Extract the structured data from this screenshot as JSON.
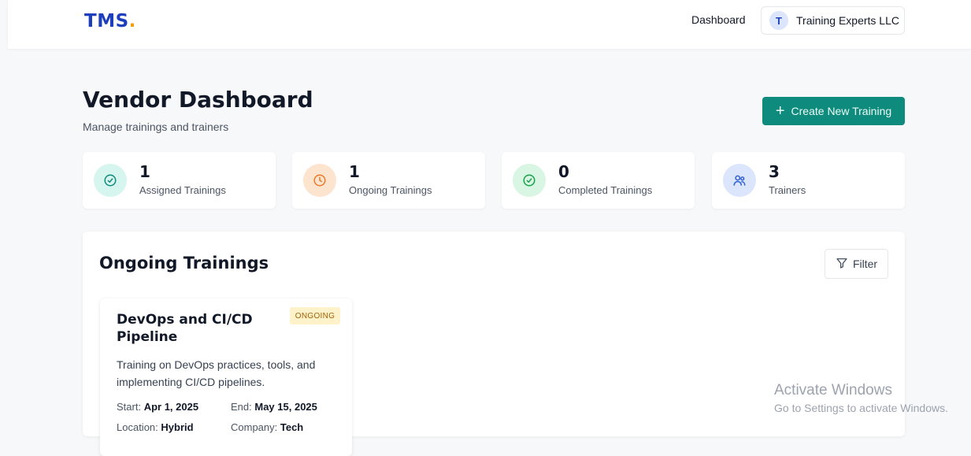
{
  "header": {
    "logo_text": "TMS",
    "logo_dot": ".",
    "nav_dashboard": "Dashboard",
    "user_initial": "T",
    "user_name": "Training Experts LLC"
  },
  "page": {
    "title": "Vendor Dashboard",
    "subtitle": "Manage trainings and trainers",
    "create_button": "Create New Training"
  },
  "stats": [
    {
      "value": "1",
      "label": "Assigned Trainings",
      "icon": "check-circle-icon",
      "color": "#0f8b7d",
      "bg": "#d6f5ee"
    },
    {
      "value": "1",
      "label": "Ongoing Trainings",
      "icon": "clock-icon",
      "color": "#ea7a2b",
      "bg": "#fde4cf"
    },
    {
      "value": "0",
      "label": "Completed Trainings",
      "icon": "check-circle-icon",
      "color": "#16a34a",
      "bg": "#d9f5e3"
    },
    {
      "value": "3",
      "label": "Trainers",
      "icon": "users-icon",
      "color": "#2f5fd0",
      "bg": "#dbe5fb"
    }
  ],
  "ongoing": {
    "title": "Ongoing Trainings",
    "filter_label": "Filter",
    "trainings": [
      {
        "title": "DevOps and CI/CD Pipeline",
        "status": "ONGOING",
        "description": "Training on DevOps practices, tools, and implementing CI/CD pipelines.",
        "start_label": "Start:",
        "start": "Apr 1, 2025",
        "end_label": "End:",
        "end": "May 15, 2025",
        "location_label": "Location:",
        "location": "Hybrid",
        "company_label": "Company:",
        "company": "Tech"
      }
    ]
  },
  "watermark": {
    "title": "Activate Windows",
    "subtitle": "Go to Settings to activate Windows."
  },
  "colors": {
    "brand": "#1e3fbd",
    "accent": "#f59e0b",
    "primary_button": "#0f8b7d"
  }
}
